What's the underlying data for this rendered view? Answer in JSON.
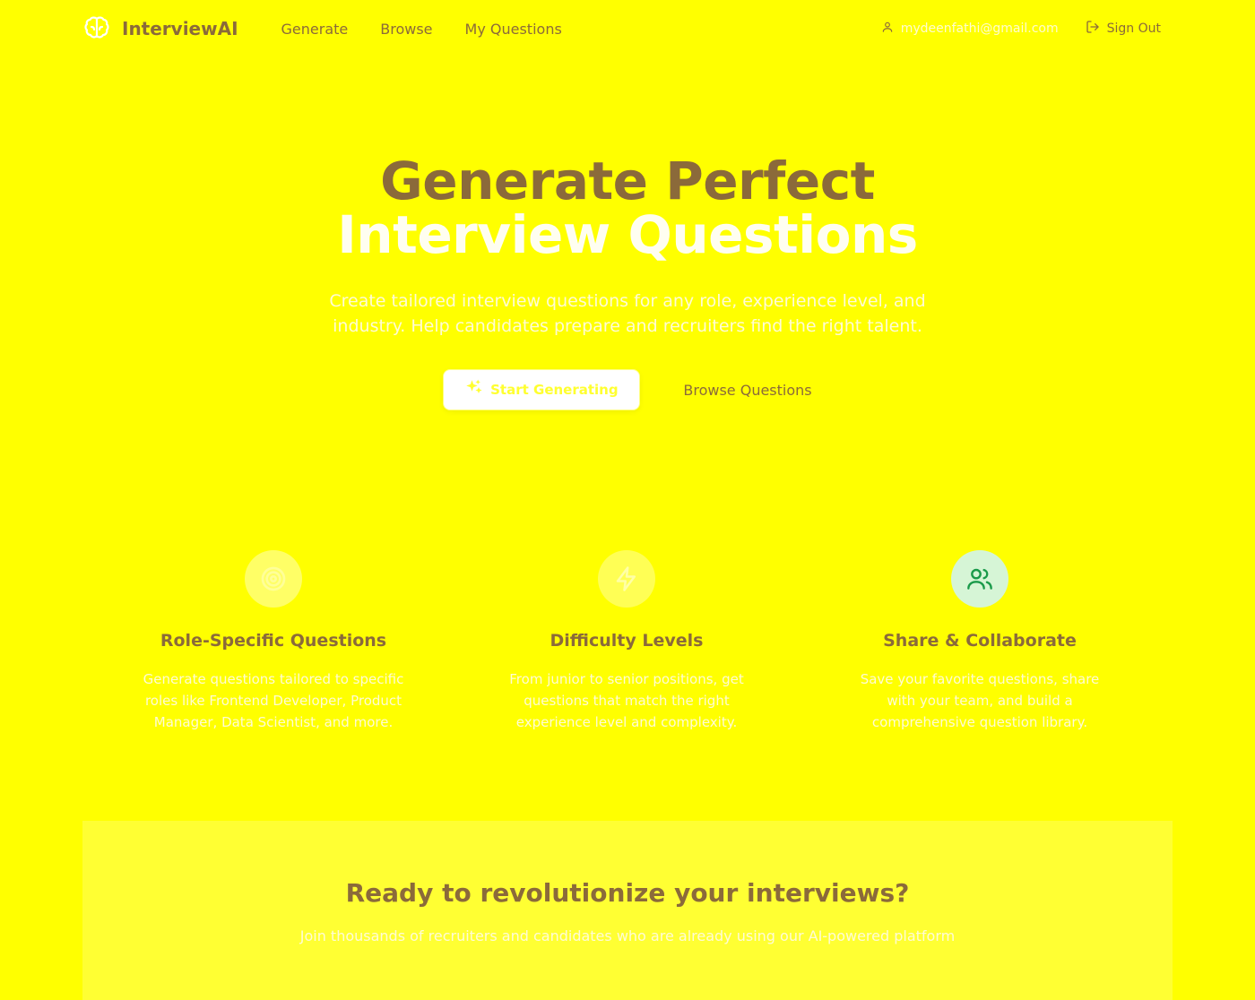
{
  "nav": {
    "brand": "InterviewAI",
    "links": [
      "Generate",
      "Browse",
      "My Questions"
    ],
    "user_email": "mydeenfathi@gmail.com",
    "sign_out": "Sign Out"
  },
  "hero": {
    "title_line1": "Generate Perfect",
    "title_line2": "Interview Questions",
    "subtitle": "Create tailored interview questions for any role, experience level, and industry. Help candidates prepare and recruiters find the right talent.",
    "primary_cta": "Start Generating",
    "secondary_cta": "Browse Questions"
  },
  "features": [
    {
      "icon": "target-icon",
      "title": "Role-Specific Questions",
      "desc": "Generate questions tailored to specific roles like Frontend Developer, Product Manager, Data Scientist, and more."
    },
    {
      "icon": "lightning-icon",
      "title": "Difficulty Levels",
      "desc": "From junior to senior positions, get questions that match the right experience level and complexity."
    },
    {
      "icon": "users-icon",
      "title": "Share & Collaborate",
      "desc": "Save your favorite questions, share with your team, and build a comprehensive question library."
    }
  ],
  "cta": {
    "title": "Ready to revolutionize your interviews?",
    "subtitle": "Join thousands of recruiters and candidates who are already using our AI-powered platform"
  },
  "colors": {
    "background": "#ffff00",
    "text_brown": "#8b6a3a",
    "icon_green": "#1a9a4a",
    "icon_green_bg": "#d6f5d6"
  }
}
